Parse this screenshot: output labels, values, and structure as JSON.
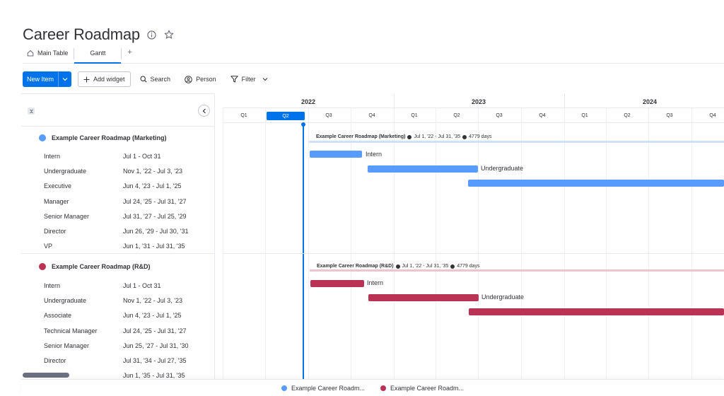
{
  "page": {
    "title": "Career Roadmap"
  },
  "tabs": [
    {
      "label": "Main Table",
      "icon": "home-icon"
    },
    {
      "label": "Gantt",
      "active": true
    },
    {
      "label": "+"
    }
  ],
  "toolbar": {
    "new_item": "New Item",
    "add_widget": "Add widget",
    "search": "Search",
    "person": "Person",
    "filter": "Filter"
  },
  "colors": {
    "accent": "#0073ea",
    "marketing": "#579bfc",
    "rnd": "#bb3354"
  },
  "timeline": {
    "years": [
      "2022",
      "2023",
      "2024"
    ],
    "quarters": [
      "Q1",
      "Q2",
      "Q3",
      "Q4",
      "Q1",
      "Q2",
      "Q3",
      "Q4",
      "Q1",
      "Q2",
      "Q3",
      "Q4"
    ],
    "current_quarter_index": 1
  },
  "groups": [
    {
      "name": "Example Career Roadmap (Marketing)",
      "color": "#579bfc",
      "summary": {
        "name": "Example Career Roadmap (Marketing)",
        "range": "Jul 1, '22 - Jul 31, '35",
        "days": "4779 days"
      },
      "items": [
        {
          "name": "Intern",
          "dates": "Jul 1 - Oct 31"
        },
        {
          "name": "Undergraduate",
          "dates": "Nov 1, '22 - Jul 3, '23"
        },
        {
          "name": "Executive",
          "dates": "Jun 4, '23 - Jul 1, '25"
        },
        {
          "name": "Manager",
          "dates": "Jul 24, '25 - Jul 31, '27"
        },
        {
          "name": "Senior Manager",
          "dates": "Jul 31, '27 - Jul 25, '29"
        },
        {
          "name": "Director",
          "dates": "Jun 26, '29 - Jul 30, '31"
        },
        {
          "name": "VP",
          "dates": "Jun 1, '31 - Jul 31, '35"
        }
      ],
      "bar_labels": [
        "Intern",
        "Undergraduate"
      ]
    },
    {
      "name": "Example Career Roadmap (R&D)",
      "color": "#bb3354",
      "summary": {
        "name": "Example Career Roadmap (R&D)",
        "range": "Jul 1, '22 - Jul 31, '35",
        "days": "4779 days"
      },
      "items": [
        {
          "name": "Intern",
          "dates": "Jul 1 - Oct 31"
        },
        {
          "name": "Undergraduate",
          "dates": "Nov 1, '22 - Jul 3, '23"
        },
        {
          "name": "Associate",
          "dates": "Jun 4, '23 - Jul 1, '25"
        },
        {
          "name": "Technical Manager",
          "dates": "Jul 24, '25 - Jul 31, '27"
        },
        {
          "name": "Senior Manager",
          "dates": "Jun 25, '27 - Jul 31, '30"
        },
        {
          "name": "Director",
          "dates": "Jul 31, '34 - Jul 27, '35"
        },
        {
          "name": "",
          "dates": "Jun 1, '35 - Jul 31, '35"
        }
      ],
      "bar_labels": [
        "Intern",
        "Undergraduate"
      ]
    }
  ],
  "legend": [
    {
      "label": "Example Career Roadm...",
      "color": "#579bfc"
    },
    {
      "label": "Example Career Roadm...",
      "color": "#bb3354"
    }
  ]
}
